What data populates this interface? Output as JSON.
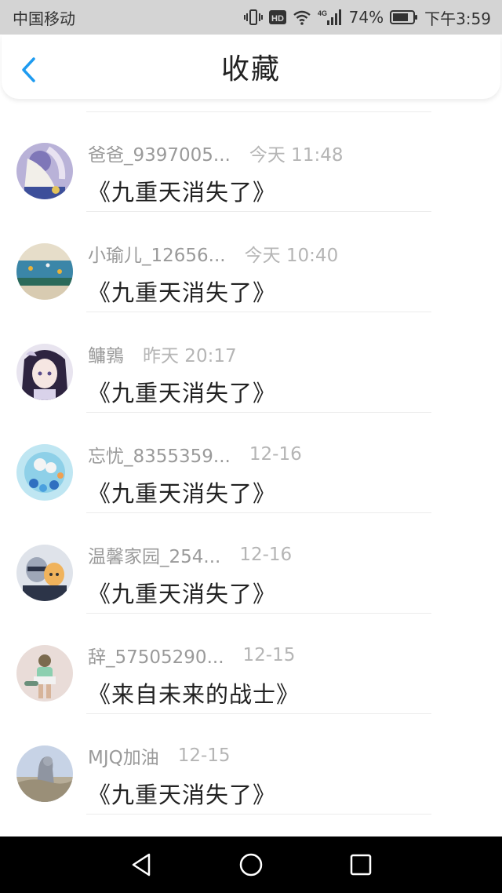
{
  "status_bar": {
    "carrier": "中国移动",
    "hd": "HD",
    "network": "4G",
    "battery": "74%",
    "time": "下午3:59"
  },
  "header": {
    "title": "收藏"
  },
  "favorites": [
    {
      "name": "爸爸_9397005...",
      "time": "今天 11:48",
      "title": "《九重天消失了》"
    },
    {
      "name": "小瑜儿_12656...",
      "time": "今天 10:40",
      "title": "《九重天消失了》"
    },
    {
      "name": "鳙鶉",
      "time": "昨天 20:17",
      "title": "《九重天消失了》"
    },
    {
      "name": "忘忧_8355359...",
      "time": "12-16",
      "title": "《九重天消失了》"
    },
    {
      "name": "温馨家园_254...",
      "time": "12-16",
      "title": "《九重天消失了》"
    },
    {
      "name": "辞_57505290...",
      "time": "12-15",
      "title": "《来自未来的战士》"
    },
    {
      "name": "MJQ加油",
      "time": "12-15",
      "title": "《九重天消失了》"
    }
  ],
  "colors": {
    "accent": "#1e9bf0",
    "status_bar": "#d4d4d4",
    "nav_bar": "#000000"
  }
}
